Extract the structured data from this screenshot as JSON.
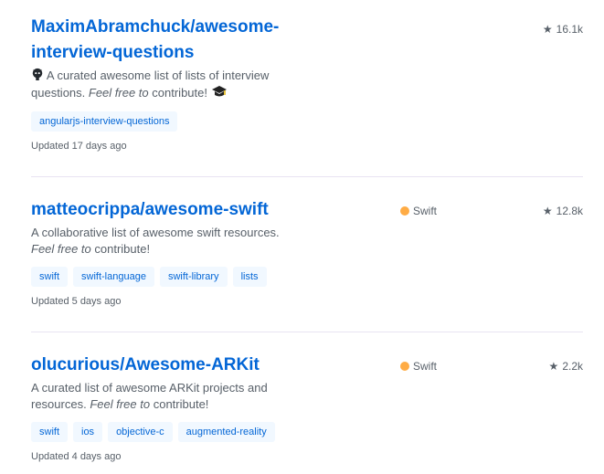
{
  "repos": [
    {
      "title": "MaximAbramchuck/awesome-interview-questions",
      "desc_lead": "A curated awesome list of lists of interview questions.",
      "desc_em": "Feel free to",
      "desc_tail": "contribute!",
      "stars": "16.1k",
      "topics": [
        "angularjs-interview-questions"
      ],
      "updated": "Updated 17 days ago"
    },
    {
      "title": "matteocrippa/awesome-swift",
      "desc_lead": "A collaborative list of awesome swift resources.",
      "desc_em": "Feel free to",
      "desc_tail": "contribute!",
      "language": "Swift",
      "language_color": "#ffac45",
      "stars": "12.8k",
      "topics": [
        "swift",
        "swift-language",
        "swift-library",
        "lists"
      ],
      "updated": "Updated 5 days ago"
    },
    {
      "title": "olucurious/Awesome-ARKit",
      "desc_lead": "A curated list of awesome ARKit projects and resources.",
      "desc_em": "Feel free to",
      "desc_tail": "contribute!",
      "language": "Swift",
      "language_color": "#ffac45",
      "stars": "2.2k",
      "topics": [
        "swift",
        "ios",
        "objective-c",
        "augmented-reality"
      ],
      "updated": "Updated 4 days ago"
    }
  ],
  "icons": {
    "star": "star-icon",
    "octocat": "octocat-icon",
    "cap": "graduation-cap-icon"
  }
}
